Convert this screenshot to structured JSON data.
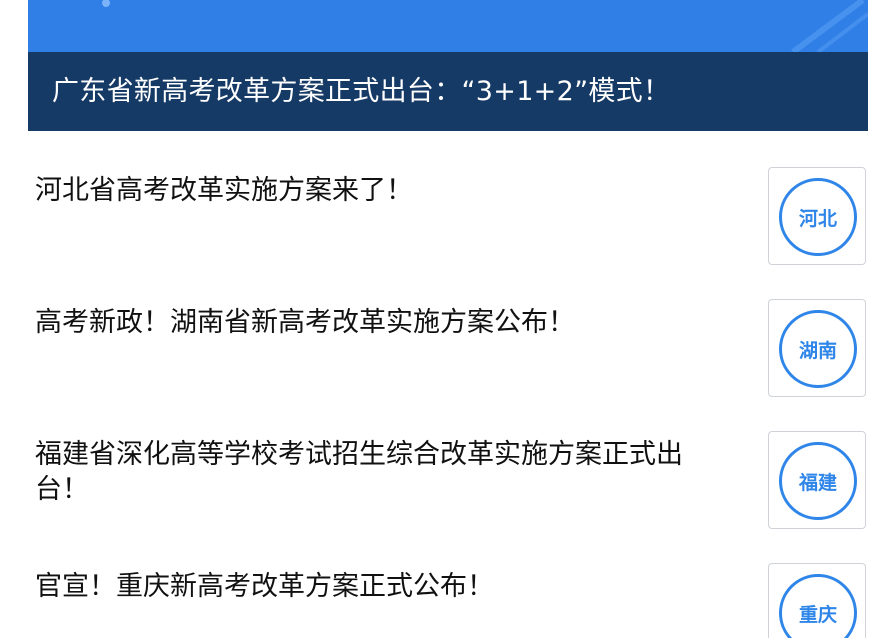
{
  "banner": {
    "title": "广东省新高考改革方案正式出台：“3+1+2”模式！"
  },
  "news": [
    {
      "title": "河北省高考改革实施方案来了！",
      "thumb_label": "河北"
    },
    {
      "title": "高考新政！湖南省新高考改革实施方案公布！",
      "thumb_label": "湖南"
    },
    {
      "title": "福建省深化高等学校考试招生综合改革实施方案正式出台！",
      "thumb_label": "福建"
    },
    {
      "title": "官宣！重庆新高考改革方案正式公布！",
      "thumb_label": "重庆"
    }
  ],
  "colors": {
    "banner_blue": "#2f7fe6",
    "banner_bar": "#163a66",
    "thumb_accent": "#2f86e8"
  }
}
